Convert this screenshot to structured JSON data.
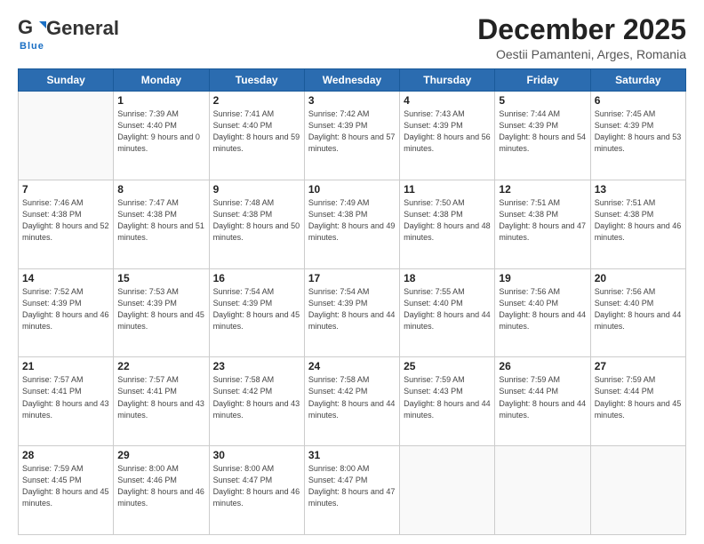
{
  "header": {
    "logo_general": "General",
    "logo_blue": "Blue",
    "title": "December 2025",
    "subtitle": "Oestii Pamanteni, Arges, Romania"
  },
  "calendar": {
    "days_of_week": [
      "Sunday",
      "Monday",
      "Tuesday",
      "Wednesday",
      "Thursday",
      "Friday",
      "Saturday"
    ],
    "weeks": [
      [
        {
          "day": "",
          "sunrise": "",
          "sunset": "",
          "daylight": ""
        },
        {
          "day": "1",
          "sunrise": "Sunrise: 7:39 AM",
          "sunset": "Sunset: 4:40 PM",
          "daylight": "Daylight: 9 hours and 0 minutes."
        },
        {
          "day": "2",
          "sunrise": "Sunrise: 7:41 AM",
          "sunset": "Sunset: 4:40 PM",
          "daylight": "Daylight: 8 hours and 59 minutes."
        },
        {
          "day": "3",
          "sunrise": "Sunrise: 7:42 AM",
          "sunset": "Sunset: 4:39 PM",
          "daylight": "Daylight: 8 hours and 57 minutes."
        },
        {
          "day": "4",
          "sunrise": "Sunrise: 7:43 AM",
          "sunset": "Sunset: 4:39 PM",
          "daylight": "Daylight: 8 hours and 56 minutes."
        },
        {
          "day": "5",
          "sunrise": "Sunrise: 7:44 AM",
          "sunset": "Sunset: 4:39 PM",
          "daylight": "Daylight: 8 hours and 54 minutes."
        },
        {
          "day": "6",
          "sunrise": "Sunrise: 7:45 AM",
          "sunset": "Sunset: 4:39 PM",
          "daylight": "Daylight: 8 hours and 53 minutes."
        }
      ],
      [
        {
          "day": "7",
          "sunrise": "Sunrise: 7:46 AM",
          "sunset": "Sunset: 4:38 PM",
          "daylight": "Daylight: 8 hours and 52 minutes."
        },
        {
          "day": "8",
          "sunrise": "Sunrise: 7:47 AM",
          "sunset": "Sunset: 4:38 PM",
          "daylight": "Daylight: 8 hours and 51 minutes."
        },
        {
          "day": "9",
          "sunrise": "Sunrise: 7:48 AM",
          "sunset": "Sunset: 4:38 PM",
          "daylight": "Daylight: 8 hours and 50 minutes."
        },
        {
          "day": "10",
          "sunrise": "Sunrise: 7:49 AM",
          "sunset": "Sunset: 4:38 PM",
          "daylight": "Daylight: 8 hours and 49 minutes."
        },
        {
          "day": "11",
          "sunrise": "Sunrise: 7:50 AM",
          "sunset": "Sunset: 4:38 PM",
          "daylight": "Daylight: 8 hours and 48 minutes."
        },
        {
          "day": "12",
          "sunrise": "Sunrise: 7:51 AM",
          "sunset": "Sunset: 4:38 PM",
          "daylight": "Daylight: 8 hours and 47 minutes."
        },
        {
          "day": "13",
          "sunrise": "Sunrise: 7:51 AM",
          "sunset": "Sunset: 4:38 PM",
          "daylight": "Daylight: 8 hours and 46 minutes."
        }
      ],
      [
        {
          "day": "14",
          "sunrise": "Sunrise: 7:52 AM",
          "sunset": "Sunset: 4:39 PM",
          "daylight": "Daylight: 8 hours and 46 minutes."
        },
        {
          "day": "15",
          "sunrise": "Sunrise: 7:53 AM",
          "sunset": "Sunset: 4:39 PM",
          "daylight": "Daylight: 8 hours and 45 minutes."
        },
        {
          "day": "16",
          "sunrise": "Sunrise: 7:54 AM",
          "sunset": "Sunset: 4:39 PM",
          "daylight": "Daylight: 8 hours and 45 minutes."
        },
        {
          "day": "17",
          "sunrise": "Sunrise: 7:54 AM",
          "sunset": "Sunset: 4:39 PM",
          "daylight": "Daylight: 8 hours and 44 minutes."
        },
        {
          "day": "18",
          "sunrise": "Sunrise: 7:55 AM",
          "sunset": "Sunset: 4:40 PM",
          "daylight": "Daylight: 8 hours and 44 minutes."
        },
        {
          "day": "19",
          "sunrise": "Sunrise: 7:56 AM",
          "sunset": "Sunset: 4:40 PM",
          "daylight": "Daylight: 8 hours and 44 minutes."
        },
        {
          "day": "20",
          "sunrise": "Sunrise: 7:56 AM",
          "sunset": "Sunset: 4:40 PM",
          "daylight": "Daylight: 8 hours and 44 minutes."
        }
      ],
      [
        {
          "day": "21",
          "sunrise": "Sunrise: 7:57 AM",
          "sunset": "Sunset: 4:41 PM",
          "daylight": "Daylight: 8 hours and 43 minutes."
        },
        {
          "day": "22",
          "sunrise": "Sunrise: 7:57 AM",
          "sunset": "Sunset: 4:41 PM",
          "daylight": "Daylight: 8 hours and 43 minutes."
        },
        {
          "day": "23",
          "sunrise": "Sunrise: 7:58 AM",
          "sunset": "Sunset: 4:42 PM",
          "daylight": "Daylight: 8 hours and 43 minutes."
        },
        {
          "day": "24",
          "sunrise": "Sunrise: 7:58 AM",
          "sunset": "Sunset: 4:42 PM",
          "daylight": "Daylight: 8 hours and 44 minutes."
        },
        {
          "day": "25",
          "sunrise": "Sunrise: 7:59 AM",
          "sunset": "Sunset: 4:43 PM",
          "daylight": "Daylight: 8 hours and 44 minutes."
        },
        {
          "day": "26",
          "sunrise": "Sunrise: 7:59 AM",
          "sunset": "Sunset: 4:44 PM",
          "daylight": "Daylight: 8 hours and 44 minutes."
        },
        {
          "day": "27",
          "sunrise": "Sunrise: 7:59 AM",
          "sunset": "Sunset: 4:44 PM",
          "daylight": "Daylight: 8 hours and 45 minutes."
        }
      ],
      [
        {
          "day": "28",
          "sunrise": "Sunrise: 7:59 AM",
          "sunset": "Sunset: 4:45 PM",
          "daylight": "Daylight: 8 hours and 45 minutes."
        },
        {
          "day": "29",
          "sunrise": "Sunrise: 8:00 AM",
          "sunset": "Sunset: 4:46 PM",
          "daylight": "Daylight: 8 hours and 46 minutes."
        },
        {
          "day": "30",
          "sunrise": "Sunrise: 8:00 AM",
          "sunset": "Sunset: 4:47 PM",
          "daylight": "Daylight: 8 hours and 46 minutes."
        },
        {
          "day": "31",
          "sunrise": "Sunrise: 8:00 AM",
          "sunset": "Sunset: 4:47 PM",
          "daylight": "Daylight: 8 hours and 47 minutes."
        },
        {
          "day": "",
          "sunrise": "",
          "sunset": "",
          "daylight": ""
        },
        {
          "day": "",
          "sunrise": "",
          "sunset": "",
          "daylight": ""
        },
        {
          "day": "",
          "sunrise": "",
          "sunset": "",
          "daylight": ""
        }
      ]
    ]
  }
}
